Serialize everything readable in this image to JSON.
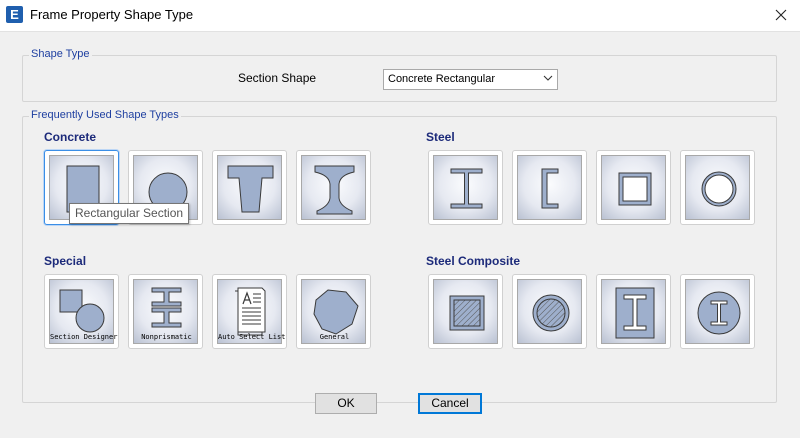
{
  "window": {
    "title": "Frame Property Shape Type",
    "app_icon_letter": "E"
  },
  "shape_type_group": {
    "legend": "Shape Type",
    "section_shape_label": "Section Shape",
    "section_shape_value": "Concrete Rectangular"
  },
  "frequent_group": {
    "legend": "Frequently Used Shape Types"
  },
  "categories": {
    "concrete": "Concrete",
    "steel": "Steel",
    "special": "Special",
    "steel_composite": "Steel Composite"
  },
  "special_captions": {
    "section_designer": "Section Designer",
    "nonprismatic": "Nonprismatic",
    "auto_select": "Auto Select List",
    "general": "General"
  },
  "tooltip": "Rectangular Section",
  "buttons": {
    "ok": "OK",
    "cancel": "Cancel"
  },
  "colors": {
    "shape_fill": "#9eafcc",
    "shape_stroke": "#3a3a3a",
    "category_title": "#1c2a7a",
    "legend": "#1e3fa0"
  }
}
